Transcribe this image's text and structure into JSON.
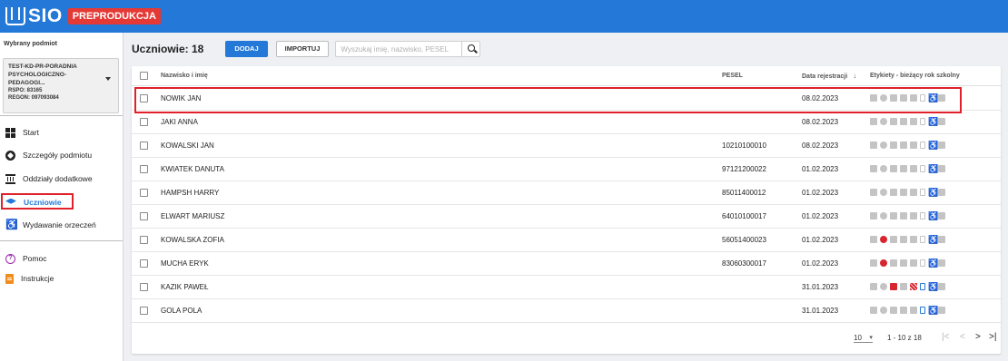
{
  "app": {
    "logo_text": "SIO",
    "environment_badge": "PREPRODUKCJA",
    "brand_color": "#2378d8"
  },
  "sidebar": {
    "heading": "Wybrany podmiot",
    "entity": {
      "name": "TEST-KD-PR-PORADNIA PSYCHOLOGICZNO-PEDAGOGI...",
      "rspo": "RSPO: 83165",
      "regon": "REGON: 097093084"
    },
    "nav": [
      {
        "label": "Start",
        "icon": "dashboard-icon"
      },
      {
        "label": "Szczegóły podmiotu",
        "icon": "details-icon"
      },
      {
        "label": "Oddziały dodatkowe",
        "icon": "institution-icon"
      },
      {
        "label": "Uczniowie",
        "icon": "graduation-cap-icon",
        "active": true
      },
      {
        "label": "Wydawanie orzeczeń",
        "icon": "accessibility-icon"
      }
    ],
    "secondary_nav": [
      {
        "label": "Pomoc",
        "icon": "help-icon"
      },
      {
        "label": "Instrukcje",
        "icon": "document-icon"
      }
    ]
  },
  "main": {
    "title": "Uczniowie: 18",
    "add_button": "DODAJ",
    "import_button": "IMPORTUJ",
    "search_placeholder": "Wyszukaj imię, nazwisko, PESEL",
    "table": {
      "columns": {
        "name": "Nazwisko i imię",
        "pesel": "PESEL",
        "date": "Data rejestracji",
        "sort_indicator": "↓",
        "tags": "Etykiety - bieżący rok szkolny"
      },
      "rows": [
        {
          "name": "NOWIK JAN",
          "pesel": "",
          "date": "08.02.2023"
        },
        {
          "name": "JAKI ANNA",
          "pesel": "",
          "date": "08.02.2023"
        },
        {
          "name": "KOWALSKI JAN",
          "pesel": "10210100010",
          "date": "08.02.2023"
        },
        {
          "name": "KWIATEK DANUTA",
          "pesel": "97121200022",
          "date": "01.02.2023"
        },
        {
          "name": "HAMPSH HARRY",
          "pesel": "85011400012",
          "date": "01.02.2023"
        },
        {
          "name": "ELWART MARIUSZ",
          "pesel": "64010100017",
          "date": "01.02.2023"
        },
        {
          "name": "KOWALSKA ZOFIA",
          "pesel": "56051400023",
          "date": "01.02.2023"
        },
        {
          "name": "MUCHA ERYK",
          "pesel": "83060300017",
          "date": "01.02.2023"
        },
        {
          "name": "KAZIK PAWEŁ",
          "pesel": "",
          "date": "31.01.2023"
        },
        {
          "name": "GOLA POLA",
          "pesel": "",
          "date": "31.01.2023"
        }
      ]
    },
    "pagination": {
      "page_size": "10",
      "range": "1 - 10 z 18",
      "first": "|<",
      "prev": "<",
      "next": ">",
      "last": ">|"
    }
  }
}
